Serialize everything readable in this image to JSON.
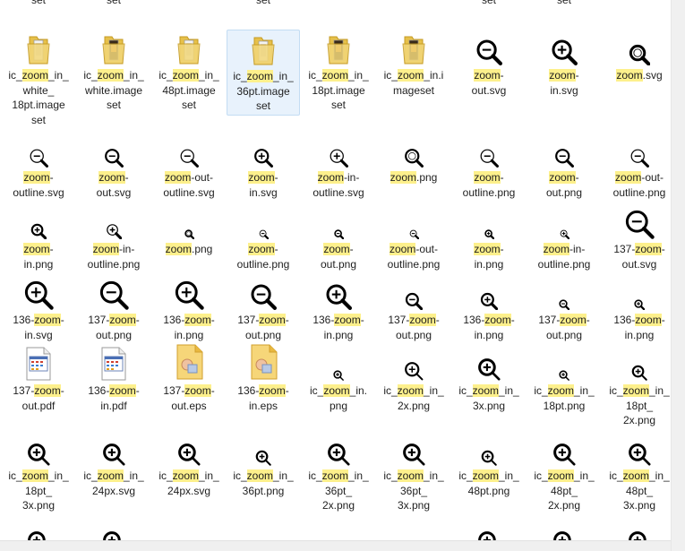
{
  "highlight_term": "zoom",
  "colors": {
    "highlight": "#fdf08c",
    "selection": "#e8f2fc",
    "selection_border": "#c3dcf3"
  },
  "rows": [
    {
      "top_partial": true,
      "items": [
        {
          "lines": [
            "set"
          ],
          "icon": "folder-icon"
        },
        {
          "lines": [
            "set"
          ],
          "icon": "folder-icon"
        },
        {
          "lines": [
            ""
          ],
          "icon": "folder-icon"
        },
        {
          "lines": [
            "set"
          ],
          "icon": "folder-icon"
        },
        {
          "lines": [
            ""
          ],
          "icon": "folder-icon"
        },
        {
          "lines": [
            ""
          ],
          "icon": "folder-icon"
        },
        {
          "lines": [
            "set"
          ],
          "icon": "folder-icon"
        },
        {
          "lines": [
            "set"
          ],
          "icon": "folder-icon"
        },
        {
          "lines": [
            ""
          ],
          "icon": "folder-icon"
        }
      ]
    },
    {
      "items": [
        {
          "lines": [
            "ic_zoom_in_",
            "white_",
            "18pt.image",
            "set"
          ],
          "icon": "folder-image-white-icon"
        },
        {
          "lines": [
            "ic_zoom_in_",
            "white.image",
            "set"
          ],
          "icon": "folder-image-dark-icon"
        },
        {
          "lines": [
            "ic_zoom_in_",
            "48pt.image",
            "set"
          ],
          "icon": "folder-image-white-icon"
        },
        {
          "lines": [
            "ic_zoom_in_",
            "36pt.image",
            "set"
          ],
          "icon": "folder-image-white-icon",
          "selected": true
        },
        {
          "lines": [
            "ic_zoom_in_",
            "18pt.image",
            "set"
          ],
          "icon": "folder-image-dark-icon"
        },
        {
          "lines": [
            "ic_zoom_in.i",
            "mageset"
          ],
          "icon": "folder-image-dark-icon"
        },
        {
          "lines": [
            "zoom-",
            "out.svg"
          ],
          "icon": "zoom-out-icon",
          "size": 30
        },
        {
          "lines": [
            "zoom-",
            "in.svg"
          ],
          "icon": "zoom-in-icon",
          "size": 30
        },
        {
          "lines": [
            "zoom.svg"
          ],
          "icon": "zoom-icon",
          "size": 24
        }
      ]
    },
    {
      "items": [
        {
          "lines": [
            "zoom-",
            "outline.svg"
          ],
          "icon": "zoom-outline-icon",
          "size": 22
        },
        {
          "lines": [
            "zoom-",
            "out.svg"
          ],
          "icon": "zoom-out-icon",
          "size": 22
        },
        {
          "lines": [
            "zoom-out-",
            "outline.svg"
          ],
          "icon": "zoom-out-outline-icon",
          "size": 22
        },
        {
          "lines": [
            "zoom-",
            "in.svg"
          ],
          "icon": "zoom-in-icon",
          "size": 22
        },
        {
          "lines": [
            "zoom-in-",
            "outline.svg"
          ],
          "icon": "zoom-in-outline-icon",
          "size": 22
        },
        {
          "lines": [
            "zoom.png"
          ],
          "icon": "zoom-icon",
          "size": 22
        },
        {
          "lines": [
            "zoom-",
            "outline.png"
          ],
          "icon": "zoom-outline-icon",
          "size": 22
        },
        {
          "lines": [
            "zoom-",
            "out.png"
          ],
          "icon": "zoom-out-icon",
          "size": 22
        },
        {
          "lines": [
            "zoom-out-",
            "outline.png"
          ],
          "icon": "zoom-out-outline-icon",
          "size": 22
        }
      ]
    },
    {
      "items": [
        {
          "lines": [
            "zoom-",
            "in.png"
          ],
          "icon": "zoom-in-icon",
          "size": 18
        },
        {
          "lines": [
            "zoom-in-",
            "outline.png"
          ],
          "icon": "zoom-in-outline-icon",
          "size": 18
        },
        {
          "lines": [
            "zoom.png"
          ],
          "icon": "zoom-icon",
          "size": 11
        },
        {
          "lines": [
            "zoom-",
            "outline.png"
          ],
          "icon": "zoom-outline-icon",
          "size": 11
        },
        {
          "lines": [
            "zoom-",
            "out.png"
          ],
          "icon": "zoom-out-icon",
          "size": 11
        },
        {
          "lines": [
            "zoom-out-",
            "outline.png"
          ],
          "icon": "zoom-out-outline-icon",
          "size": 11
        },
        {
          "lines": [
            "zoom-",
            "in.png"
          ],
          "icon": "zoom-in-icon",
          "size": 11
        },
        {
          "lines": [
            "zoom-in-",
            "outline.png"
          ],
          "icon": "zoom-in-outline-icon",
          "size": 11
        },
        {
          "lines": [
            "137-zoom-",
            "out.svg"
          ],
          "icon": "zoom-out-icon",
          "size": 34
        }
      ]
    },
    {
      "items": [
        {
          "lines": [
            "136-zoom-",
            "in.svg"
          ],
          "icon": "zoom-in-icon",
          "size": 34
        },
        {
          "lines": [
            "137-zoom-",
            "out.png"
          ],
          "icon": "zoom-out-icon",
          "size": 34
        },
        {
          "lines": [
            "136-zoom-",
            "in.png"
          ],
          "icon": "zoom-in-icon",
          "size": 34
        },
        {
          "lines": [
            "137-zoom-",
            "out.png"
          ],
          "icon": "zoom-out-icon",
          "size": 30
        },
        {
          "lines": [
            "136-zoom-",
            "in.png"
          ],
          "icon": "zoom-in-icon",
          "size": 30
        },
        {
          "lines": [
            "137-zoom-",
            "out.png"
          ],
          "icon": "zoom-out-icon",
          "size": 20
        },
        {
          "lines": [
            "136-zoom-",
            "in.png"
          ],
          "icon": "zoom-in-icon",
          "size": 20
        },
        {
          "lines": [
            "137-zoom-",
            "out.png"
          ],
          "icon": "zoom-out-icon",
          "size": 12
        },
        {
          "lines": [
            "136-zoom-",
            "in.png"
          ],
          "icon": "zoom-in-icon",
          "size": 12
        }
      ]
    },
    {
      "items": [
        {
          "lines": [
            "137-zoom-",
            "out.pdf"
          ],
          "icon": "pdf-file-icon"
        },
        {
          "lines": [
            "136-zoom-",
            "in.pdf"
          ],
          "icon": "pdf-file-icon"
        },
        {
          "lines": [
            "137-zoom-",
            "out.eps"
          ],
          "icon": "eps-file-icon"
        },
        {
          "lines": [
            "136-zoom-",
            "in.eps"
          ],
          "icon": "eps-file-icon"
        },
        {
          "lines": [
            "ic_zoom_in.",
            "png"
          ],
          "icon": "zoom-in-glass-icon",
          "size": 12
        },
        {
          "lines": [
            "ic_zoom_in_",
            "2x.png"
          ],
          "icon": "zoom-in-glass-icon",
          "size": 22
        },
        {
          "lines": [
            "ic_zoom_in_",
            "3x.png"
          ],
          "icon": "zoom-in-glass-icon",
          "size": 26
        },
        {
          "lines": [
            "ic_zoom_in_",
            "18pt.png"
          ],
          "icon": "zoom-in-glass-icon",
          "size": 12
        },
        {
          "lines": [
            "ic_zoom_in_",
            "18pt_",
            "2x.png"
          ],
          "icon": "zoom-in-glass-icon",
          "size": 18
        }
      ]
    },
    {
      "items": [
        {
          "lines": [
            "ic_zoom_in_",
            "18pt_",
            "3x.png"
          ],
          "icon": "zoom-in-glass-icon",
          "size": 26
        },
        {
          "lines": [
            "ic_zoom_in_",
            "24px.svg"
          ],
          "icon": "zoom-in-glass-icon",
          "size": 26
        },
        {
          "lines": [
            "ic_zoom_in_",
            "24px.svg"
          ],
          "icon": "zoom-in-glass-icon",
          "size": 26
        },
        {
          "lines": [
            "ic_zoom_in_",
            "36pt.png"
          ],
          "icon": "zoom-in-glass-icon",
          "size": 18
        },
        {
          "lines": [
            "ic_zoom_in_",
            "36pt_",
            "2x.png"
          ],
          "icon": "zoom-in-glass-icon",
          "size": 26
        },
        {
          "lines": [
            "ic_zoom_in_",
            "36pt_",
            "3x.png"
          ],
          "icon": "zoom-in-glass-icon",
          "size": 26
        },
        {
          "lines": [
            "ic_zoom_in_",
            "48pt.png"
          ],
          "icon": "zoom-in-glass-icon",
          "size": 18
        },
        {
          "lines": [
            "ic_zoom_in_",
            "48pt_",
            "2x.png"
          ],
          "icon": "zoom-in-glass-icon",
          "size": 26
        },
        {
          "lines": [
            "ic_zoom_in_",
            "48pt_",
            "3x.png"
          ],
          "icon": "zoom-in-glass-icon",
          "size": 26
        }
      ]
    },
    {
      "bottom_partial": true,
      "items": [
        {
          "lines": [
            ""
          ],
          "icon": "zoom-in-glass-icon",
          "size": 26
        },
        {
          "lines": [
            ""
          ],
          "icon": "zoom-in-glass-icon",
          "size": 26
        },
        {
          "lines": [
            ""
          ],
          "icon": "zoom-in-glass-icon",
          "size": 12
        },
        {
          "lines": [
            ""
          ],
          "icon": "zoom-in-glass-icon",
          "size": 10
        },
        {
          "lines": [
            ""
          ],
          "icon": "zoom-in-glass-icon",
          "size": 12
        },
        {
          "lines": [
            ""
          ],
          "icon": "zoom-in-glass-icon",
          "size": 10
        },
        {
          "lines": [
            ""
          ],
          "icon": "zoom-in-glass-icon",
          "size": 26
        },
        {
          "lines": [
            ""
          ],
          "icon": "zoom-in-glass-icon",
          "size": 26
        },
        {
          "lines": [
            ""
          ],
          "icon": "zoom-in-glass-icon",
          "size": 26
        }
      ]
    }
  ]
}
